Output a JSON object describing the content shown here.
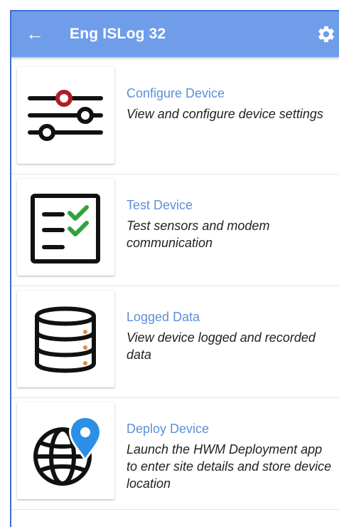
{
  "appbar": {
    "title": "Eng ISLog 32",
    "back_icon": "arrow-left-icon",
    "settings_icon": "gear-icon"
  },
  "colors": {
    "appbar": "#6f9de9",
    "title_link": "#5d8fd8",
    "accent_red": "#b01e24",
    "check_green": "#2fa33c",
    "accent_orange": "#e08a44",
    "pin_blue": "#2c8fe6"
  },
  "items": [
    {
      "title": "Configure Device",
      "desc": "View and configure device settings",
      "icon": "sliders-icon"
    },
    {
      "title": "Test Device",
      "desc": "Test sensors and modem communication",
      "icon": "checklist-icon"
    },
    {
      "title": "Logged Data",
      "desc": "View device logged and recorded data",
      "icon": "database-icon"
    },
    {
      "title": "Deploy Device",
      "desc": "Launch the HWM Deployment app to enter site details and store device location",
      "icon": "globe-pin-icon"
    }
  ]
}
